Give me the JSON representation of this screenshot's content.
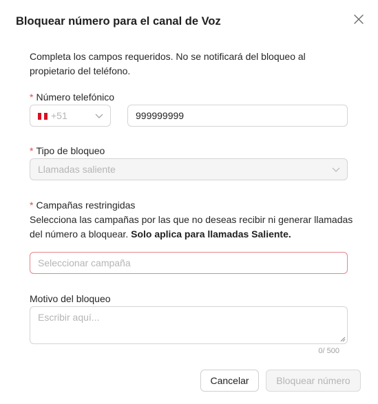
{
  "dialog": {
    "title": "Bloquear número para el canal de Voz",
    "intro": "Completa los campos requeridos. No se notificará del bloqueo al propietario del teléfono."
  },
  "phone": {
    "label": "Número telefónico",
    "required_mark": "*",
    "prefix": "+51",
    "flag_icon": "peru-flag-icon",
    "flag_colors": [
      "#d91023",
      "#ffffff",
      "#d91023"
    ],
    "number_value": "999999999"
  },
  "block_type": {
    "label": "Tipo de bloqueo",
    "required_mark": "*",
    "value": "Llamadas saliente"
  },
  "campaigns": {
    "label": "Campañas restringidas",
    "required_mark": "*",
    "description": "Selecciona las campañas por las que no deseas recibir ni generar llamadas del número a bloquear.",
    "description_bold": "Solo aplica para llamadas Saliente.",
    "placeholder": "Seleccionar campaña",
    "error_border_color": "#e5848a"
  },
  "reason": {
    "label": "Motivo del bloqueo",
    "placeholder": "Escribir aquí...",
    "counter": "0/ 500"
  },
  "buttons": {
    "cancel": "Cancelar",
    "submit": "Bloquear número"
  }
}
